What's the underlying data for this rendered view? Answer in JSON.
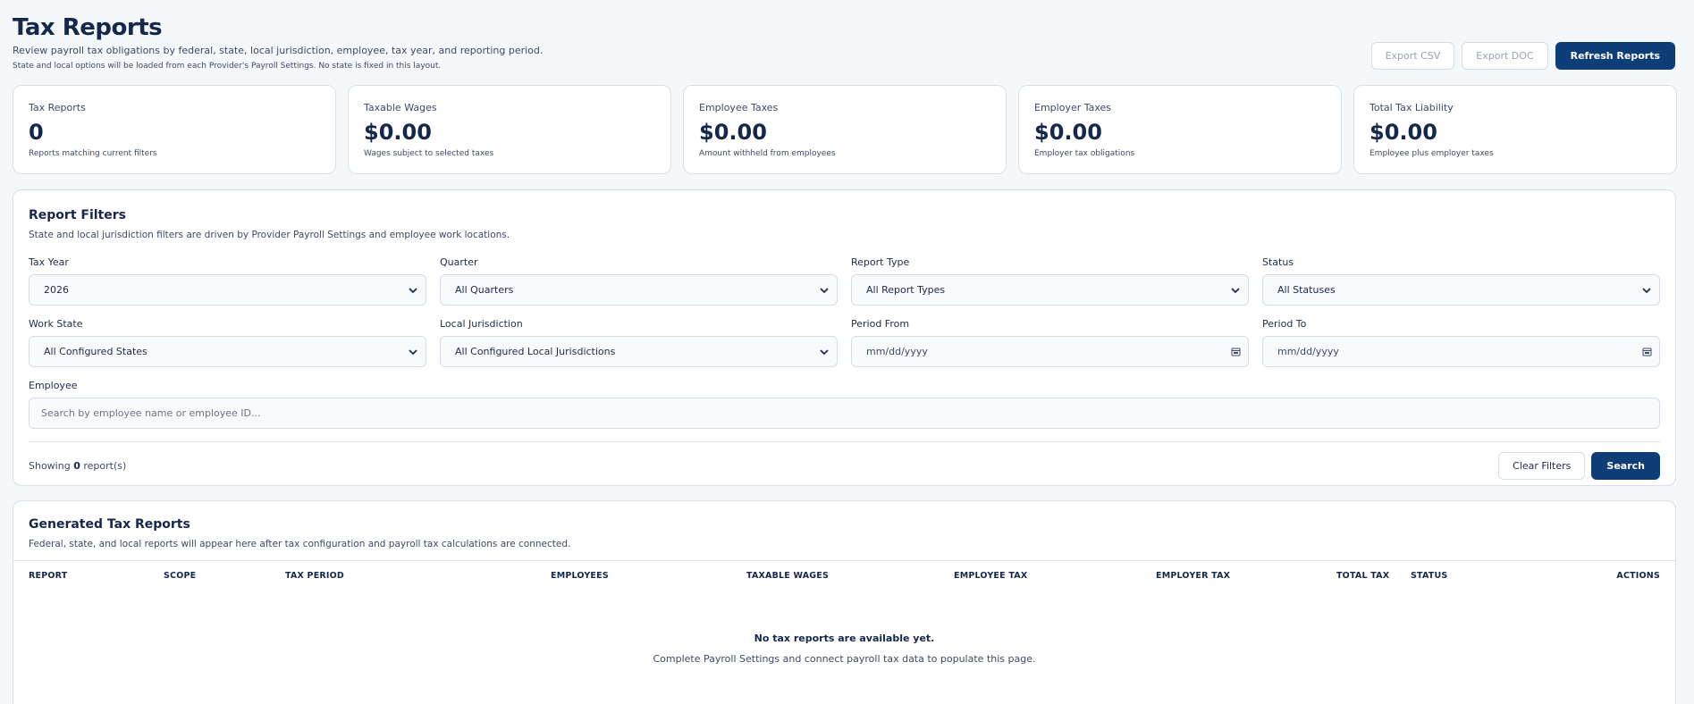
{
  "header": {
    "title": "Tax Reports",
    "subtitle": "Review payroll tax obligations by federal, state, local jurisdiction, employee, tax year, and reporting period.",
    "note": "State and local options will be loaded from each Provider's Payroll Settings. No state is fixed in this layout.",
    "export_csv": "Export CSV",
    "export_doc": "Export DOC",
    "refresh": "Refresh Reports"
  },
  "stats": [
    {
      "label": "Tax Reports",
      "value": "0",
      "desc": "Reports matching current filters"
    },
    {
      "label": "Taxable Wages",
      "value": "$0.00",
      "desc": "Wages subject to selected taxes"
    },
    {
      "label": "Employee Taxes",
      "value": "$0.00",
      "desc": "Amount withheld from employees"
    },
    {
      "label": "Employer Taxes",
      "value": "$0.00",
      "desc": "Employer tax obligations"
    },
    {
      "label": "Total Tax Liability",
      "value": "$0.00",
      "desc": "Employee plus employer taxes"
    }
  ],
  "filters": {
    "title": "Report Filters",
    "subtitle": "State and local jurisdiction filters are driven by Provider Payroll Settings and employee work locations.",
    "tax_year": {
      "label": "Tax Year",
      "value": "2026"
    },
    "quarter": {
      "label": "Quarter",
      "value": "All Quarters"
    },
    "report_type": {
      "label": "Report Type",
      "value": "All Report Types"
    },
    "status": {
      "label": "Status",
      "value": "All Statuses"
    },
    "work_state": {
      "label": "Work State",
      "value": "All Configured States"
    },
    "local": {
      "label": "Local Jurisdiction",
      "value": "All Configured Local Jurisdictions"
    },
    "period_from": {
      "label": "Period From",
      "value": "mm/dd/yyyy"
    },
    "period_to": {
      "label": "Period To",
      "value": "mm/dd/yyyy"
    },
    "employee": {
      "label": "Employee",
      "placeholder": "Search by employee name or employee ID..."
    },
    "showing_prefix": "Showing",
    "showing_count": "0",
    "showing_suffix": "report(s)",
    "clear": "Clear Filters",
    "search": "Search"
  },
  "reports": {
    "title": "Generated Tax Reports",
    "subtitle": "Federal, state, and local reports will appear here after tax configuration and payroll tax calculations are connected.",
    "columns": [
      "REPORT",
      "SCOPE",
      "TAX PERIOD",
      "EMPLOYEES",
      "TAXABLE WAGES",
      "EMPLOYEE TAX",
      "EMPLOYER TAX",
      "TOTAL TAX",
      "STATUS",
      "ACTIONS"
    ],
    "empty_title": "No tax reports are available yet.",
    "empty_sub": "Complete Payroll Settings and connect payroll tax data to populate this page."
  }
}
